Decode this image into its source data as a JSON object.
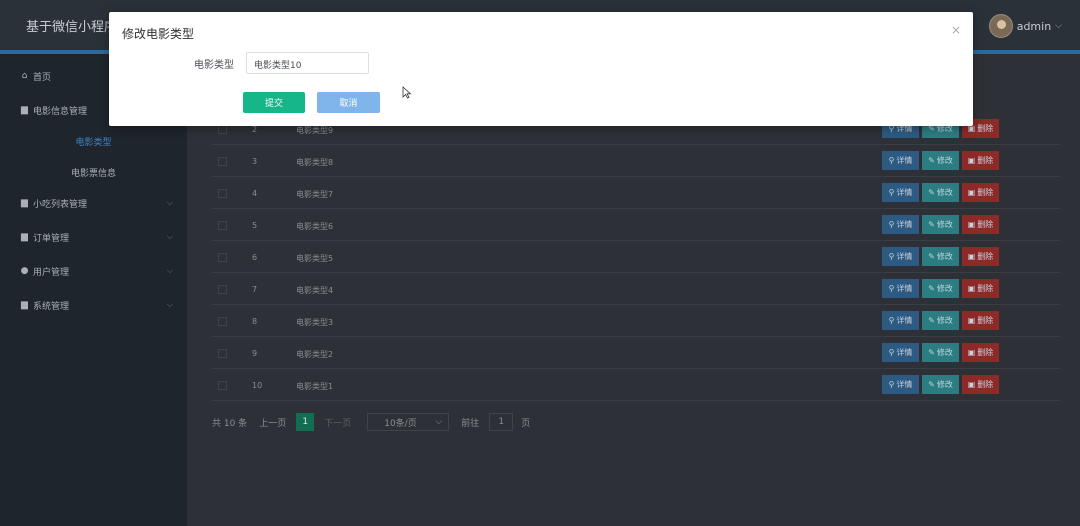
{
  "app": {
    "title": "基于微信小程序"
  },
  "user": {
    "name": "admin",
    "caret": "⌵"
  },
  "sidebar": {
    "items": [
      {
        "label": "首页",
        "icon": "home-icon",
        "glyph": "⌂"
      },
      {
        "label": "电影信息管理",
        "icon": "folder-icon",
        "glyph": "▆"
      },
      {
        "label": "小吃列表管理",
        "icon": "box-icon",
        "glyph": "▆",
        "arrow": "⌵"
      },
      {
        "label": "订单管理",
        "icon": "document-icon",
        "glyph": "▆",
        "arrow": "⌵"
      },
      {
        "label": "用户管理",
        "icon": "user-icon",
        "glyph": "●",
        "arrow": "⌵"
      },
      {
        "label": "系统管理",
        "icon": "settings-icon",
        "glyph": "▆",
        "arrow": "⌵"
      }
    ],
    "subitems": [
      {
        "label": "电影类型",
        "active": true
      },
      {
        "label": "电影票信息",
        "active": false
      }
    ]
  },
  "table": {
    "rows": [
      {
        "index": "2",
        "name": "电影类型9"
      },
      {
        "index": "3",
        "name": "电影类型8"
      },
      {
        "index": "4",
        "name": "电影类型7"
      },
      {
        "index": "5",
        "name": "电影类型6"
      },
      {
        "index": "6",
        "name": "电影类型5"
      },
      {
        "index": "7",
        "name": "电影类型4"
      },
      {
        "index": "8",
        "name": "电影类型3"
      },
      {
        "index": "9",
        "name": "电影类型2"
      },
      {
        "index": "10",
        "name": "电影类型1"
      }
    ],
    "actions": {
      "detail": "详情",
      "edit": "修改",
      "delete": "删除"
    }
  },
  "pagination": {
    "total": "共 10 条",
    "prev": "上一页",
    "current": "1",
    "next": "下一页",
    "page_size": "10条/页",
    "goto_label": "前往",
    "goto_value": "1",
    "page_suffix": "页"
  },
  "modal": {
    "title": "修改电影类型",
    "close": "×",
    "field_label": "电影类型",
    "field_value": "电影类型10",
    "submit": "提交",
    "cancel": "取消"
  },
  "colors": {
    "submit": "#16b689",
    "cancel": "#80b5ec",
    "active_menu": "#3f86c7"
  }
}
